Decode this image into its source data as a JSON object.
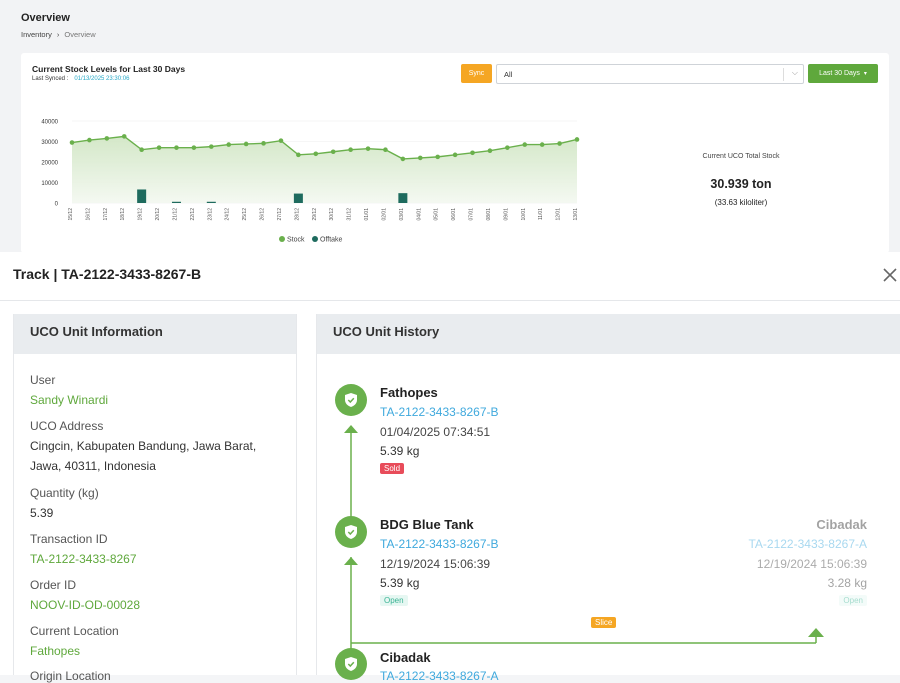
{
  "header": {
    "title": "Overview",
    "breadcrumb": [
      "Inventory",
      "Overview"
    ],
    "breadcrumb_sep": "›"
  },
  "chart_card": {
    "title": "Current Stock Levels for Last 30 Days",
    "last_synced_label": "Last Synced :",
    "last_synced_value": "01/13/2025 23:30:06",
    "sync_label": "Sync",
    "filter_value": "All",
    "range_label": "Last 30 Days",
    "total_label": "Current UCO Total Stock",
    "total_ton": "30.939 ton",
    "total_kl": "(33.63 kiloliter)"
  },
  "chart_data": {
    "type": "area",
    "categories": [
      "15/12",
      "16/12",
      "17/12",
      "18/12",
      "19/12",
      "20/12",
      "21/12",
      "22/12",
      "23/12",
      "24/12",
      "25/12",
      "26/12",
      "27/12",
      "28/12",
      "29/12",
      "30/12",
      "31/12",
      "01/01",
      "02/01",
      "03/01",
      "04/01",
      "05/01",
      "06/01",
      "07/01",
      "08/01",
      "09/01",
      "10/01",
      "11/01",
      "12/01",
      "13/01"
    ],
    "series": [
      {
        "name": "Stock",
        "type": "area",
        "color": "#6ab04c",
        "values": [
          29500,
          30700,
          31500,
          32500,
          26000,
          27000,
          27000,
          27000,
          27500,
          28500,
          28800,
          29100,
          30400,
          23500,
          24000,
          25000,
          26000,
          26500,
          26000,
          21500,
          22000,
          22500,
          23500,
          24500,
          25500,
          27000,
          28500,
          28500,
          29000,
          31000
        ]
      },
      {
        "name": "Offtake",
        "type": "bar",
        "color": "#1e6b5e",
        "values": [
          0,
          0,
          0,
          0,
          6600,
          0,
          600,
          0,
          600,
          0,
          0,
          0,
          0,
          4600,
          0,
          0,
          0,
          0,
          0,
          4800,
          0,
          0,
          0,
          0,
          0,
          0,
          0,
          0,
          0,
          0
        ]
      }
    ],
    "yticks": [
      0,
      10000,
      20000,
      30000,
      40000
    ],
    "ylim": [
      0,
      40000
    ],
    "legend": "bottom"
  },
  "modal": {
    "title": "Track | TA-2122-3433-8267-B",
    "info_header": "UCO Unit Information",
    "history_header": "UCO Unit History",
    "fields": {
      "user_label": "User",
      "user_value": "Sandy Winardi",
      "address_label": "UCO Address",
      "address_value": "Cingcin, Kabupaten Bandung, Jawa Barat, Jawa, 40311, Indonesia",
      "quantity_label": "Quantity (kg)",
      "quantity_value": "5.39",
      "transaction_label": "Transaction ID",
      "transaction_value": "TA-2122-3433-8267",
      "order_label": "Order ID",
      "order_value": "NOOV-ID-OD-00028",
      "location_label": "Current Location",
      "location_value": "Fathopes",
      "origin_label": "Origin Location"
    },
    "history": {
      "n1": {
        "title": "Fathopes",
        "id": "TA-2122-3433-8267-B",
        "time": "01/04/2025 07:34:51",
        "weight": "5.39 kg",
        "badge": "Sold"
      },
      "n2": {
        "title": "BDG Blue Tank",
        "id": "TA-2122-3433-8267-B",
        "time": "12/19/2024 15:06:39",
        "weight": "5.39 kg",
        "badge": "Open"
      },
      "n2_right": {
        "title": "Cibadak",
        "id": "TA-2122-3433-8267-A",
        "time": "12/19/2024 15:06:39",
        "weight": "3.28 kg",
        "badge": "Open"
      },
      "slice_label": "Slice",
      "n3": {
        "title": "Cibadak",
        "id": "TA-2122-3433-8267-A"
      }
    }
  }
}
